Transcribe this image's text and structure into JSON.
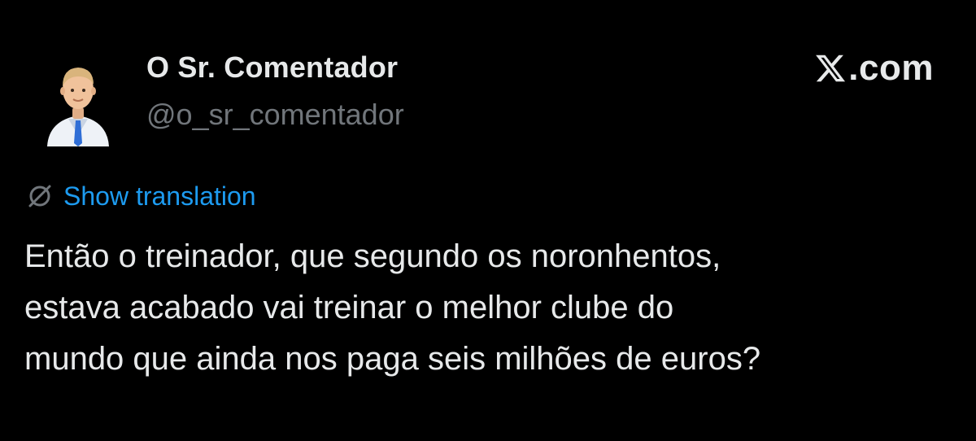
{
  "author": {
    "name": "O Sr. Comentador",
    "handle": "@o_sr_comentador"
  },
  "brand": {
    "icon": "x-logo-icon",
    "suffix": ".com"
  },
  "translation": {
    "icon": "translate-icon",
    "label": "Show translation",
    "color": "#1d9bf0"
  },
  "tweet": {
    "lines": [
      "Então o treinador, que segundo os noronhentos,",
      "estava acabado vai treinar o melhor clube do",
      "mundo que ainda nos paga seis milhões de euros?"
    ]
  },
  "colors": {
    "background": "#000000",
    "text": "#e7e9ea",
    "secondary": "#71767b",
    "link": "#1d9bf0"
  }
}
